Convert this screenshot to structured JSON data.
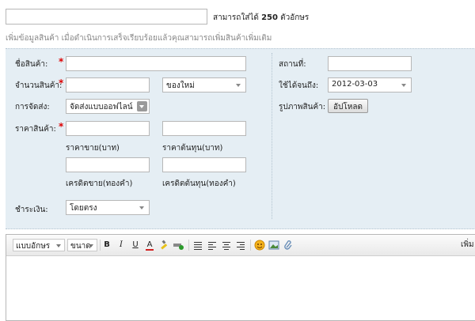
{
  "top": {
    "name_value": "",
    "counter_text": "สามารถใส่ได้",
    "counter_number": "250",
    "counter_unit": "ตัวอักษร",
    "info_text": "เพิ่มข้อมูลสินค้า เมื่อดำเนินการเสร็จเรียบร้อยแล้วคุณสามารถเพิ่มสินค้าเพิ่มเติม"
  },
  "form": {
    "product_name_label": "ชื่อสินค้า:",
    "product_name_value": "",
    "quantity_label": "จำนวนสินค้า:",
    "quantity_value": "",
    "condition_value": "ของใหม่",
    "shipping_label": "การจัดส่ง:",
    "shipping_value": "จัดส่งแบบออฟไลน์",
    "price_label": "ราคาสินค้า:",
    "sell_price_caption": "ราคาขาย(บาท)",
    "cost_price_caption": "ราคาต้นทุน(บาท)",
    "sell_credit_caption": "เครดิตขาย(ทองคำ)",
    "cost_credit_caption": "เครดิตต้นทุน(ทองคำ)",
    "payment_label": "ชำระเงิน:",
    "payment_value": "โดยตรง",
    "location_label": "สถานที่:",
    "location_value": "",
    "valid_until_label": "ใช้ได้จนถึง:",
    "valid_until_value": "2012-03-03",
    "image_label": "รูปภาพสินค้า:",
    "upload_button": "อัปโหลด",
    "required_mark": "*"
  },
  "editor": {
    "font_dropdown": "แบบอักษร",
    "size_dropdown": "ขนาด",
    "bold": "B",
    "italic": "I",
    "underline": "U",
    "font_color": "A",
    "right_partial": "เพิ่ม"
  },
  "colors": {
    "panel_bg": "#e5eef4",
    "required": "#dd0000",
    "font_color_bar": "#d22020"
  }
}
